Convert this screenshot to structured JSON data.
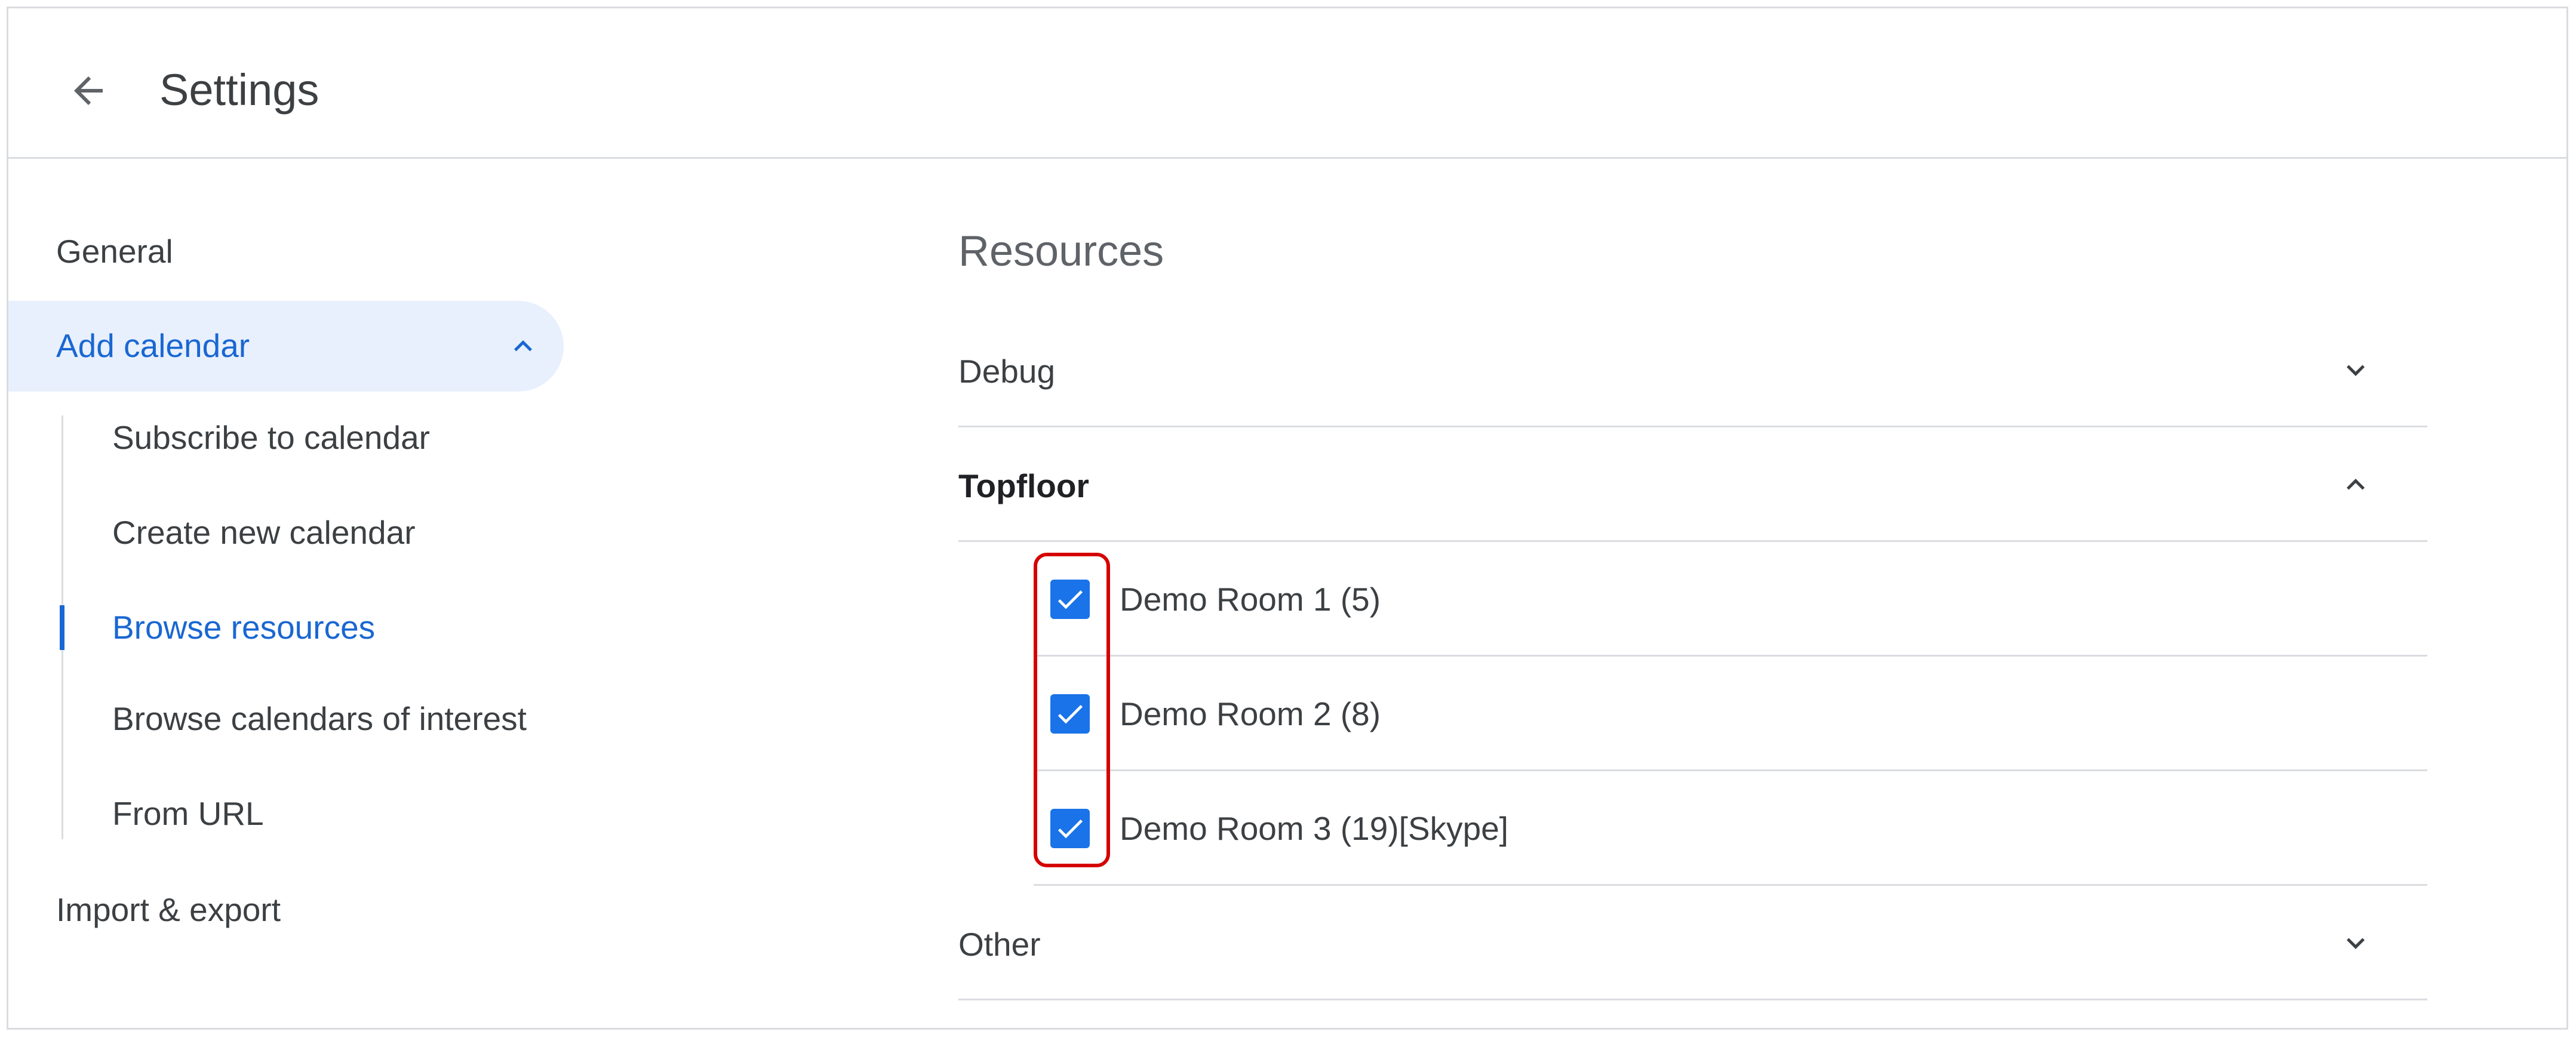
{
  "header": {
    "title": "Settings",
    "back_icon": "arrow-back-icon"
  },
  "sidebar": {
    "general": "General",
    "add_calendar": {
      "label": "Add calendar",
      "expanded": true,
      "icon": "chevron-up-icon"
    },
    "sub_items": [
      {
        "label": "Subscribe to calendar",
        "active": false
      },
      {
        "label": "Create new calendar",
        "active": false
      },
      {
        "label": "Browse resources",
        "active": true
      },
      {
        "label": "Browse calendars of interest",
        "active": false
      },
      {
        "label": "From URL",
        "active": false
      }
    ],
    "import_export": "Import & export"
  },
  "main": {
    "section_title": "Resources",
    "groups": [
      {
        "label": "Debug",
        "expanded": false,
        "icon": "chevron-down-icon"
      },
      {
        "label": "Topfloor",
        "expanded": true,
        "icon": "chevron-up-icon"
      },
      {
        "label": "Other",
        "expanded": false,
        "icon": "chevron-down-icon"
      }
    ],
    "rooms": [
      {
        "label": "Demo Room 1 (5)",
        "checked": true
      },
      {
        "label": "Demo Room 2 (8)",
        "checked": true
      },
      {
        "label": "Demo Room 3 (19)[Skype]",
        "checked": true
      }
    ]
  },
  "colors": {
    "accent": "#1967d2",
    "checkbox": "#1a73e8",
    "active_background": "#e8f0fe",
    "divider": "#dadce0",
    "highlight": "#d50000"
  }
}
